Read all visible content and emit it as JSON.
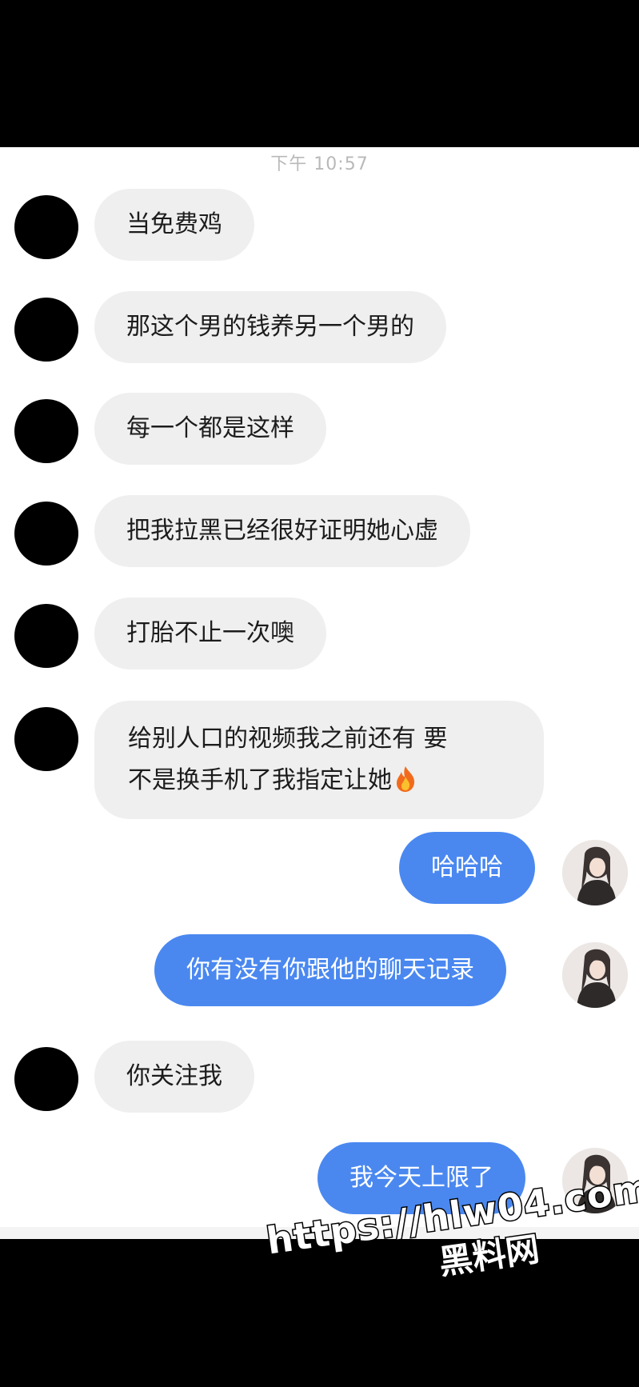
{
  "chat": {
    "timestamp": "下午 10:57",
    "messages": [
      {
        "side": "in",
        "text": "当免费鸡"
      },
      {
        "side": "in",
        "text": "那这个男的钱养另一个男的"
      },
      {
        "side": "in",
        "text": "每一个都是这样"
      },
      {
        "side": "in",
        "text": "把我拉黑已经很好证明她心虚"
      },
      {
        "side": "in",
        "text": "打胎不止一次噢"
      },
      {
        "side": "in",
        "line1": "给别人口的视频我之前还有 要",
        "line2": "不是换手机了我指定让她",
        "emoji": "fire-icon"
      },
      {
        "side": "out",
        "text": "哈哈哈"
      },
      {
        "side": "out",
        "text": "你有没有你跟他的聊天记录"
      },
      {
        "side": "in",
        "text": "你关注我"
      },
      {
        "side": "out",
        "text": "我今天上限了"
      }
    ]
  },
  "watermark": {
    "url": "https://hlw04.com",
    "name": "黑料网"
  },
  "colors": {
    "incoming_bubble": "#efefef",
    "outgoing_bubble": "#4a88f0",
    "background": "#ffffff",
    "bars": "#000000"
  }
}
